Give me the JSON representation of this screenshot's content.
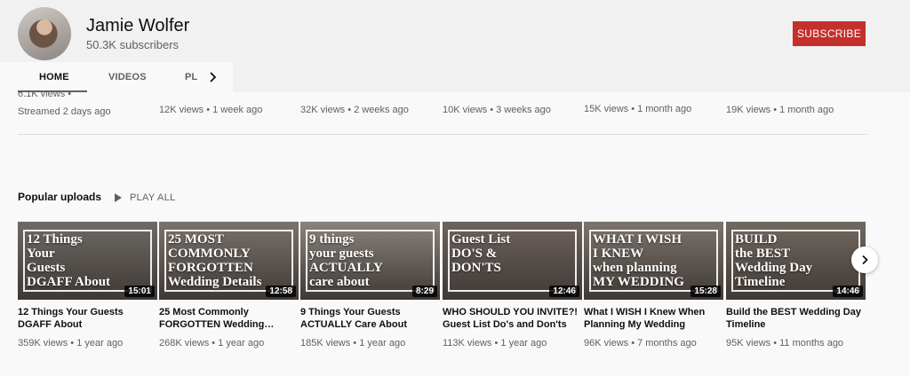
{
  "channel": {
    "name": "Jamie Wolfer",
    "subscribers": "50.3K subscribers",
    "subscribe_label": "SUBSCRIBE"
  },
  "tabs": [
    {
      "label": "HOME"
    },
    {
      "label": "VIDEOS"
    },
    {
      "label": "PL"
    }
  ],
  "previous_row": [
    {
      "views": "6.1K views •",
      "age": "Streamed 2 days ago"
    },
    {
      "meta": "12K views • 1 week ago"
    },
    {
      "meta": "32K views • 2 weeks ago"
    },
    {
      "meta": "10K views • 3 weeks ago"
    },
    {
      "meta": "15K views • 1 month ago"
    },
    {
      "meta": "19K views • 1 month ago"
    }
  ],
  "popular": {
    "title": "Popular uploads",
    "play_all": "PLAY ALL",
    "videos": [
      {
        "thumb_text": "12 Things\nYour\nGuests\nDGAFF About",
        "duration": "15:01",
        "title": "12 Things Your Guests DGAFF About",
        "meta": "359K views • 1 year ago",
        "color": "#6e6a66"
      },
      {
        "thumb_text": "25 MOST\nCOMMONLY\nFORGOTTEN\nWedding Details",
        "duration": "12:58",
        "title": "25 Most Commonly FORGOTTEN Wedding…",
        "meta": "268K views • 1 year ago",
        "color": "#7a726c"
      },
      {
        "thumb_text": "9 things\nyour guests\nACTUALLY\ncare about",
        "duration": "8:29",
        "title": "9 Things Your Guests ACTUALLY Care About",
        "meta": "185K views • 1 year ago",
        "color": "#8a837d"
      },
      {
        "thumb_text": "Guest List\nDO'S &\nDON'TS",
        "duration": "12:46",
        "title": "WHO SHOULD YOU INVITE?! Guest List Do's and Don'ts",
        "meta": "113K views • 1 year ago",
        "color": "#6d625e"
      },
      {
        "thumb_text": "WHAT I WISH\nI KNEW\nwhen planning\nMY WEDDING",
        "duration": "15:28",
        "title": "What I WISH I Knew When Planning My Wedding",
        "meta": "96K views • 7 months ago",
        "color": "#7c746d"
      },
      {
        "thumb_text": "BUILD\nthe BEST\nWedding Day\nTimeline",
        "duration": "14:46",
        "title": "Build the BEST Wedding Day Timeline",
        "meta": "95K views • 11 months ago",
        "color": "#716860"
      }
    ]
  },
  "icons": {
    "tabs_next": "chevron-right-icon",
    "play": "play-icon",
    "carousel_next": "chevron-right-icon"
  }
}
